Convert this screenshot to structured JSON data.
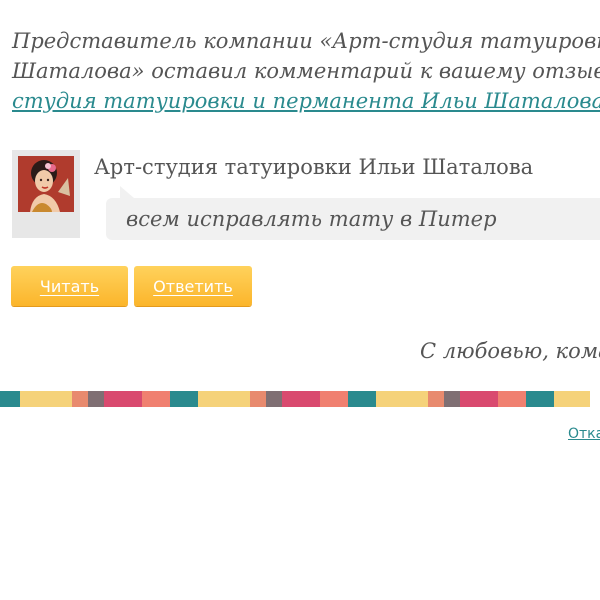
{
  "intro": {
    "line1": "Представитель компании «Арт-студия татуировки И",
    "line2": "Шаталова» оставил комментарий к вашему отзыву о",
    "link": "студия татуировки и перманента Ильи Шаталова"
  },
  "comment": {
    "company_name": "Арт-студия татуировки Ильи Шаталова",
    "text": "всем исправлять тату в Питер",
    "avatar_icon": "avatar-portrait-icon"
  },
  "buttons": {
    "read_label": "Читать",
    "reply_label": "Ответить",
    "color_top": "#ffd25c",
    "color_bottom": "#fbb52b"
  },
  "signature": "С любовью, кома",
  "footer": {
    "link_label": "Отка"
  },
  "colors": {
    "text": "#555555",
    "link": "#2a8a8e",
    "bubble": "#f1f1f1",
    "stripe": [
      "#2a8a8e",
      "#f5d27a",
      "#e88a6e",
      "#7f6f73",
      "#d94a6f",
      "#f08070",
      "#2a8a8e",
      "#f5d27a"
    ]
  }
}
